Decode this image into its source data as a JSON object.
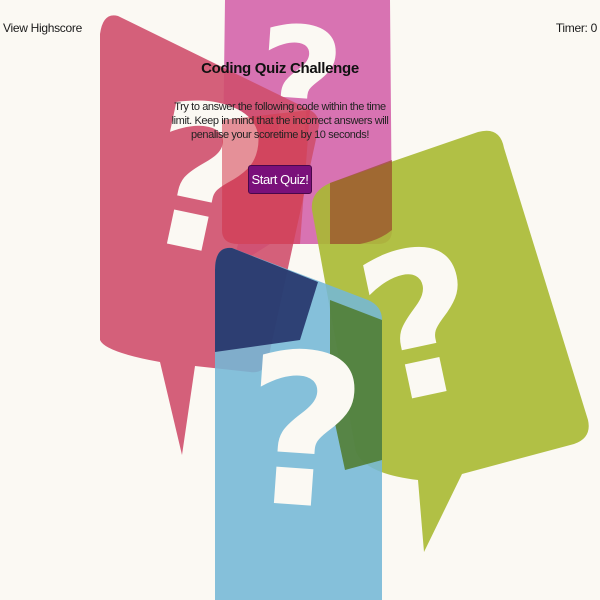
{
  "header": {
    "highscore_link": "View Highscore",
    "timer_label": "Timer: ",
    "timer_value": "0"
  },
  "intro": {
    "title": "Coding Quiz Challenge",
    "description": "Try to answer the following code within the time limit. Keep in mind that the incorrect answers will penalise your scoretime by 10 seconds!",
    "start_button": "Start Quiz!"
  },
  "background": {
    "description_icon": "question-mark-speech-bubbles",
    "colors": {
      "page": "#fbf9f3",
      "red_bubble": "#cf4f6d",
      "pink_bubble": "#d66bae",
      "green_bubble": "#a9b932",
      "blue_bubble": "#74b7d6",
      "button": "#7a107a"
    }
  }
}
